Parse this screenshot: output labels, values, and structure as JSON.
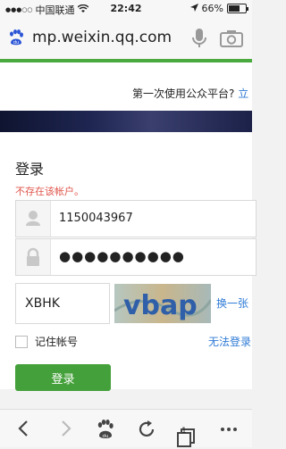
{
  "status_bar": {
    "signal": "●●●○○",
    "carrier": "中国联通",
    "time": "22:42",
    "battery": "66%",
    "battery_level": 0.66
  },
  "browser": {
    "url": "mp.weixin.qq.com",
    "du_logo_text": "du"
  },
  "header": {
    "first_time_text": "第一次使用公众平台?",
    "first_time_link": "立"
  },
  "login": {
    "title": "登录",
    "error": "不存在该帐户。",
    "account_value": "1150043967",
    "password_masked": "●●●●●●●●●●",
    "verify_value": "XBHK",
    "captcha_text": "vbap",
    "change_link": "换一张",
    "remember_label": "记住帐号",
    "cant_login_link": "无法登录",
    "login_button": "登录"
  },
  "bottom_bar": {
    "tabs_count": "1",
    "paw_text": "du"
  },
  "colors": {
    "accent_green": "#44a03a",
    "progress_green": "#4aaa3f",
    "link_blue": "#2f7bd6",
    "error_red": "#e0554b"
  }
}
